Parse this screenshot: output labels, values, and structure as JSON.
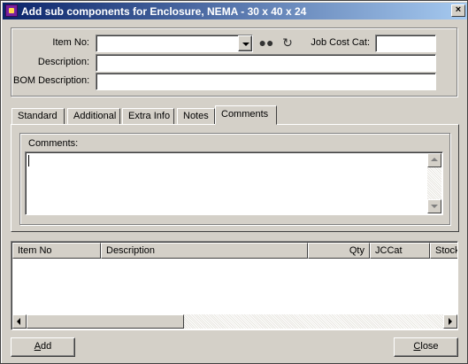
{
  "window": {
    "title": "Add sub components for Enclosure, NEMA - 30 x 40 x 24",
    "close_glyph": "×"
  },
  "form": {
    "item_no_label": "Item No:",
    "item_no_value": "",
    "job_cost_cat_label": "Job Cost Cat:",
    "job_cost_cat_value": "",
    "description_label": "Description:",
    "description_value": "",
    "bom_description_label": "BOM Description:",
    "bom_description_value": "",
    "icons": [
      "binoculars-icon",
      "refresh-icon"
    ]
  },
  "tabs": [
    {
      "label": "Standard",
      "active": false
    },
    {
      "label": "Additional",
      "active": false
    },
    {
      "label": "Extra Info",
      "active": false
    },
    {
      "label": "Notes",
      "active": false
    },
    {
      "label": "Comments",
      "active": true
    }
  ],
  "comments": {
    "label": "Comments:",
    "value": ""
  },
  "grid": {
    "columns": [
      "Item No",
      "Description",
      "Qty",
      "JCCat",
      "Stock"
    ],
    "rows": []
  },
  "buttons": {
    "add": {
      "accel": "A",
      "rest": "dd"
    },
    "close": {
      "accel": "C",
      "rest": "lose"
    }
  }
}
